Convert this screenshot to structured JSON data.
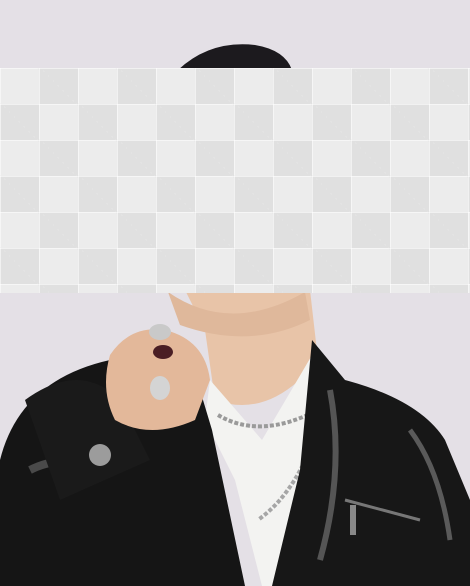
{
  "image": {
    "subject": "",
    "colors": {
      "background": "#e4e0e6",
      "jacket": "#141414",
      "jacket_highlight": "#6a6a6a",
      "shirt": "#f4f4f2",
      "skin": "#e9c7ad",
      "chain": "#a9a9a9",
      "censor_light": "#ececec",
      "censor_dark": "#e0e0e0"
    }
  }
}
